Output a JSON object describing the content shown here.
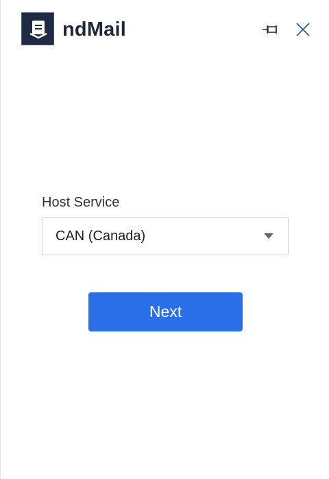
{
  "app": {
    "title": "ndMail",
    "logo_icon": "document-stack-icon"
  },
  "window_controls": {
    "pin_icon": "pin-icon",
    "close_icon": "close-icon"
  },
  "form": {
    "host_service_label": "Host Service",
    "host_service_value": "CAN (Canada)",
    "dropdown_icon": "caret-down-icon",
    "next_label": "Next"
  },
  "colors": {
    "primary": "#2a6ee8",
    "logo_bg": "#1f2b44",
    "title_text": "#1f2838",
    "icon_accent": "#2f5e9e"
  }
}
